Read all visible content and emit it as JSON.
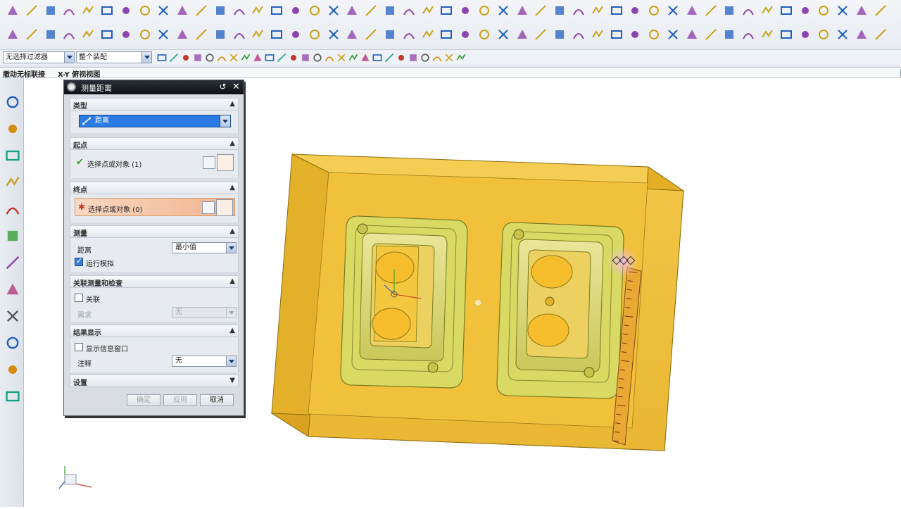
{
  "title_strip": {
    "left_label": "撤动无标联接",
    "view_label": "X-Y 俯视视图"
  },
  "selection_bar": {
    "filter_value": "无选择过滤器",
    "scope_value": "整个装配"
  },
  "dialog": {
    "title": "测量距离",
    "sections": {
      "type": {
        "header": "类型",
        "value": "距离"
      },
      "start": {
        "header": "起点",
        "pick_label": "选择点或对象 (1)"
      },
      "end": {
        "header": "终点",
        "pick_label": "选择点或对象 (0)"
      },
      "measure": {
        "header": "测量",
        "distance_label": "距离",
        "distance_value": "最小值",
        "show_dims_label": "运行模拟"
      },
      "assoc": {
        "header": "关联测量和检查",
        "assoc_label": "关联",
        "require_label": "需求",
        "require_value": "无"
      },
      "results": {
        "header": "结果显示",
        "show_info_label": "显示信息窗口",
        "annotation_label": "注释",
        "annotation_value": "无"
      },
      "settings": {
        "header": "设置"
      }
    },
    "buttons": {
      "ok": "确定",
      "apply": "应用",
      "cancel": "取消"
    }
  },
  "colors": {
    "mold_fill": "#f5c842",
    "mold_dark": "#d9a520",
    "cavity_fill": "#dde36a",
    "dialog_header": "#1a1d22",
    "active_row": "#f0b48c"
  },
  "icons": [
    "line-icon",
    "arc-icon",
    "rectangle-icon",
    "spline-icon",
    "text-icon",
    "datum-icon",
    "sketch-icon",
    "extrude-icon",
    "revolve-icon",
    "hole-icon",
    "block-icon",
    "cylinder-icon",
    "cone-icon",
    "sphere-icon",
    "measure-icon",
    "snap-point-icon",
    "circle-center-icon",
    "view-icon",
    "layer-icon"
  ]
}
